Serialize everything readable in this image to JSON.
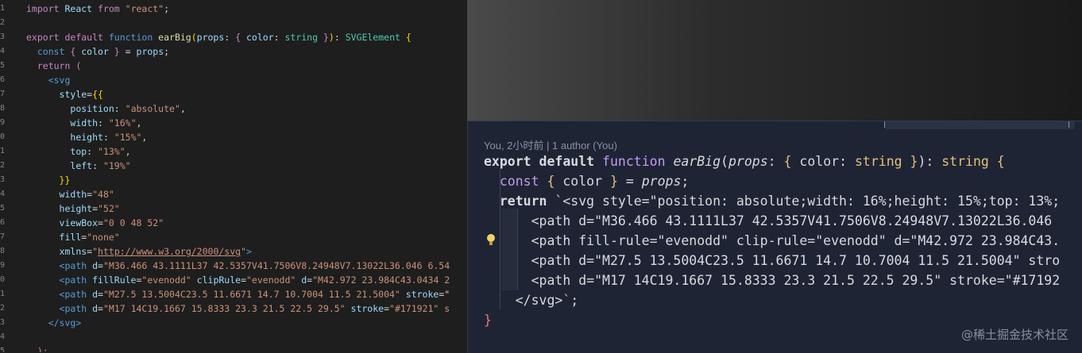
{
  "left_editor": {
    "line_numbers": [
      "1",
      "2",
      "3",
      "4",
      "5",
      "6",
      "7",
      "8",
      "9",
      "0",
      "1",
      "2",
      "3",
      "4",
      "5",
      "6",
      "7",
      "8",
      "9",
      "0",
      "1",
      "2",
      "3",
      "4",
      "5"
    ],
    "code": [
      [
        [
          "k-purple",
          "import "
        ],
        [
          "k-light",
          "React "
        ],
        [
          "k-purple",
          "from "
        ],
        [
          "k-str",
          "\"react\""
        ],
        [
          "",
          "; "
        ]
      ],
      [],
      [
        [
          "k-purple",
          "export "
        ],
        [
          "k-purple",
          "default "
        ],
        [
          "k-blue",
          "function "
        ],
        [
          "k-fn",
          "earBig"
        ],
        [
          "k-gold",
          "("
        ],
        [
          "k-light",
          "props"
        ],
        [
          "",
          ": "
        ],
        [
          "k-purple",
          "{ "
        ],
        [
          "k-light",
          "color"
        ],
        [
          "",
          ": "
        ],
        [
          "k-type",
          "string "
        ],
        [
          "k-purple",
          "}"
        ],
        [
          "k-gold",
          ")"
        ],
        [
          "",
          ": "
        ],
        [
          "k-type",
          "SVGElement "
        ],
        [
          "k-gold",
          "{"
        ]
      ],
      [
        [
          "k-blue",
          "  const "
        ],
        [
          "k-purple",
          "{ "
        ],
        [
          "k-light",
          "color "
        ],
        [
          "k-purple",
          "} "
        ],
        [
          "",
          "= "
        ],
        [
          "k-light",
          "props"
        ],
        [
          "",
          ";"
        ]
      ],
      [
        [
          "k-purple",
          "  return "
        ],
        [
          "k-purple",
          "("
        ]
      ],
      [
        [
          "",
          "    "
        ],
        [
          "k-blue",
          "<svg"
        ]
      ],
      [
        [
          "",
          "      "
        ],
        [
          "k-light",
          "style"
        ],
        [
          "",
          "="
        ],
        [
          "k-gold",
          "{{"
        ]
      ],
      [
        [
          "",
          "        "
        ],
        [
          "k-light",
          "position"
        ],
        [
          "",
          ": "
        ],
        [
          "k-str",
          "\"absolute\""
        ],
        [
          "",
          ","
        ]
      ],
      [
        [
          "",
          "        "
        ],
        [
          "k-light",
          "width"
        ],
        [
          "",
          ": "
        ],
        [
          "k-str",
          "\"16%\""
        ],
        [
          "",
          ","
        ]
      ],
      [
        [
          "",
          "        "
        ],
        [
          "k-light",
          "height"
        ],
        [
          "",
          ": "
        ],
        [
          "k-str",
          "\"15%\""
        ],
        [
          "",
          ","
        ]
      ],
      [
        [
          "",
          "        "
        ],
        [
          "k-light",
          "top"
        ],
        [
          "",
          ": "
        ],
        [
          "k-str",
          "\"13%\""
        ],
        [
          "",
          ","
        ]
      ],
      [
        [
          "",
          "        "
        ],
        [
          "k-light",
          "left"
        ],
        [
          "",
          ": "
        ],
        [
          "k-str",
          "\"19%\""
        ]
      ],
      [
        [
          "",
          "      "
        ],
        [
          "k-gold",
          "}}"
        ]
      ],
      [
        [
          "",
          "      "
        ],
        [
          "k-light",
          "width"
        ],
        [
          "",
          "="
        ],
        [
          "k-str",
          "\"48\""
        ]
      ],
      [
        [
          "",
          "      "
        ],
        [
          "k-light",
          "height"
        ],
        [
          "",
          "="
        ],
        [
          "k-str",
          "\"52\""
        ]
      ],
      [
        [
          "",
          "      "
        ],
        [
          "k-light",
          "viewBox"
        ],
        [
          "",
          "="
        ],
        [
          "k-str",
          "\"0 0 48 52\""
        ]
      ],
      [
        [
          "",
          "      "
        ],
        [
          "k-light",
          "fill"
        ],
        [
          "",
          "="
        ],
        [
          "k-str",
          "\"none\""
        ]
      ],
      [
        [
          "",
          "      "
        ],
        [
          "k-light",
          "xmlns"
        ],
        [
          "",
          "="
        ],
        [
          "k-str",
          "\""
        ],
        [
          "k-link",
          "http://www.w3.org/2000/svg"
        ],
        [
          "k-str",
          "\""
        ],
        [
          "k-blue",
          ">"
        ]
      ],
      [
        [
          "",
          "      "
        ],
        [
          "k-blue",
          "<path "
        ],
        [
          "k-light",
          "d"
        ],
        [
          "",
          "="
        ],
        [
          "k-str",
          "\"M36.466 43.1111L37 42.5357V41.7506V8.24948V7.13022L36.046 6.54"
        ]
      ],
      [
        [
          "",
          "      "
        ],
        [
          "k-blue",
          "<path "
        ],
        [
          "k-light",
          "fillRule"
        ],
        [
          "",
          "="
        ],
        [
          "k-str",
          "\"evenodd\" "
        ],
        [
          "k-light",
          "clipRule"
        ],
        [
          "",
          "="
        ],
        [
          "k-str",
          "\"evenodd\" "
        ],
        [
          "k-light",
          "d"
        ],
        [
          "",
          "="
        ],
        [
          "k-str",
          "\"M42.972 23.984C43.0434 2"
        ]
      ],
      [
        [
          "",
          "      "
        ],
        [
          "k-blue",
          "<path "
        ],
        [
          "k-light",
          "d"
        ],
        [
          "",
          "="
        ],
        [
          "k-str",
          "\"M27.5 13.5004C23.5 11.6671 14.7 10.7004 11.5 21.5004\" "
        ],
        [
          "k-light",
          "stroke"
        ],
        [
          "",
          "=\""
        ]
      ],
      [
        [
          "",
          "      "
        ],
        [
          "k-blue",
          "<path "
        ],
        [
          "k-light",
          "d"
        ],
        [
          "",
          "="
        ],
        [
          "k-str",
          "\"M17 14C19.1667 15.8333 23.3 21.5 22.5 29.5\" "
        ],
        [
          "k-light",
          "stroke"
        ],
        [
          "",
          "="
        ],
        [
          "k-str",
          "\"#171921\" s"
        ]
      ],
      [
        [
          "",
          "    "
        ],
        [
          "k-blue",
          "</svg>"
        ]
      ],
      [],
      [
        [
          "",
          "  "
        ],
        [
          "k-purple",
          ");"
        ]
      ]
    ]
  },
  "right_panel": {
    "blame": "You, 2小时前 | 1 author (You)",
    "code": [
      [
        [
          "r-bold",
          "export "
        ],
        [
          "r-bold",
          "default "
        ],
        [
          "r-kw",
          "function "
        ],
        [
          "r-ital",
          "earBig"
        ],
        [
          "",
          "("
        ],
        [
          "r-ital",
          "props"
        ],
        [
          "",
          ": "
        ],
        [
          "r-gold",
          "{ "
        ],
        [
          "",
          "color: "
        ],
        [
          "r-type",
          "string "
        ],
        [
          "r-gold",
          "}"
        ],
        [
          "",
          ")"
        ],
        [
          "",
          ": "
        ],
        [
          "r-type",
          "string "
        ],
        [
          "r-gold",
          "{"
        ]
      ],
      [
        [
          "r-kw",
          "  const "
        ],
        [
          "r-gold",
          "{ "
        ],
        [
          "",
          "color "
        ],
        [
          "r-gold",
          "} "
        ],
        [
          "",
          "= "
        ],
        [
          "r-ital",
          "props"
        ],
        [
          "",
          ";"
        ]
      ],
      [
        [
          "r-bold",
          "  return "
        ],
        [
          "",
          "`<svg style=\"position: absolute;width: 16%;height: 15%;top: 13%;"
        ]
      ],
      [
        [
          "",
          "      <path d=\"M36.466 43.1111L37 42.5357V41.7506V8.24948V7.13022L36.046"
        ]
      ],
      [
        [
          "",
          "      <path fill-rule=\"evenodd\" clip-rule=\"evenodd\" d=\"M42.972 23.984C43."
        ]
      ],
      [
        [
          "",
          "      <path d=\"M27.5 13.5004C23.5 11.6671 14.7 10.7004 11.5 21.5004\" stro"
        ]
      ],
      [
        [
          "",
          "      <path d=\"M17 14C19.1667 15.8333 23.3 21.5 22.5 29.5\" stroke=\"#17192"
        ]
      ],
      [
        [
          "",
          "    </svg>"
        ],
        [
          "r-gold",
          "`"
        ],
        [
          "",
          ";"
        ]
      ],
      [
        [
          "r-pink",
          "}"
        ]
      ]
    ]
  },
  "watermark": "@稀土掘金技术社区"
}
